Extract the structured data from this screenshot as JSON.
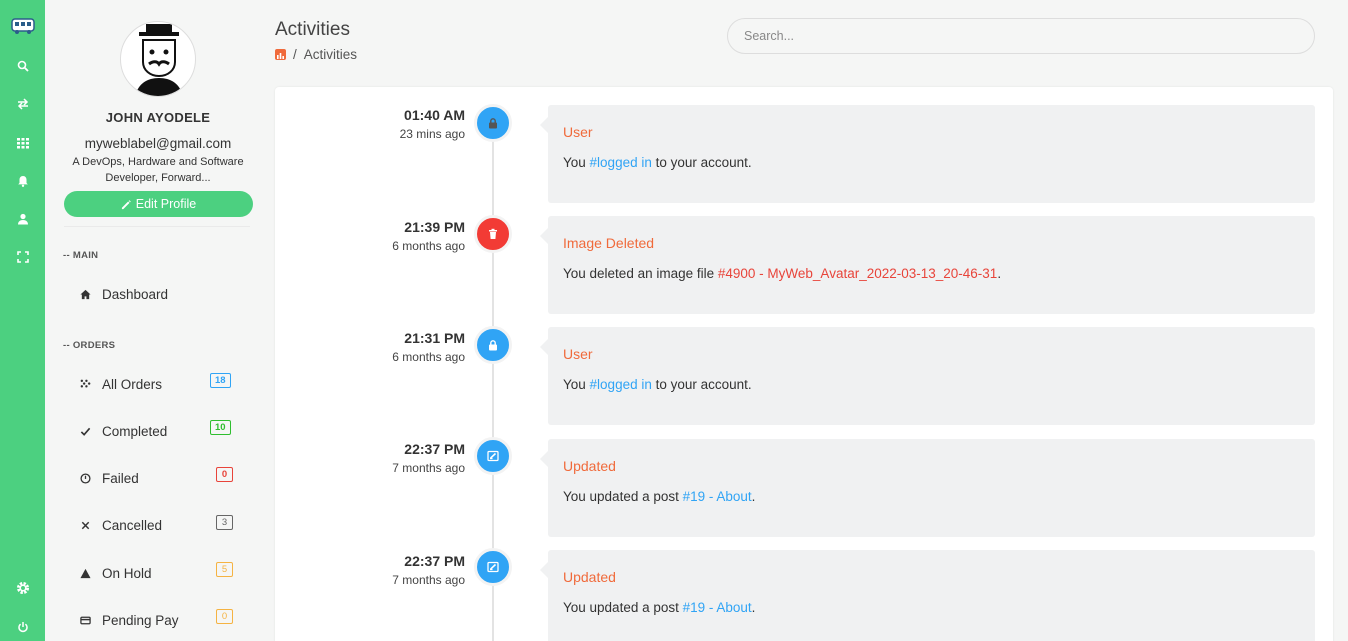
{
  "colors": {
    "accent": "#4cd080",
    "orange": "#f06a3b",
    "blue": "#30a4f5",
    "red": "#f23b35"
  },
  "rail": {
    "icons": [
      "logo-icon",
      "search-icon",
      "swap-icon",
      "grid-icon",
      "bell-icon",
      "user-icon",
      "fullscreen-icon",
      "gear-icon",
      "power-icon"
    ]
  },
  "profile": {
    "name": "JOHN AYODELE",
    "email": "myweblabel@gmail.com",
    "bio": "A DevOps, Hardware and Software Developer, Forward...",
    "edit_label": "Edit Profile"
  },
  "sidebar": {
    "main_heading": "-- MAIN",
    "dashboard_label": "Dashboard",
    "orders_heading": "-- ORDERS",
    "orders": [
      {
        "label": "All Orders",
        "count": "18",
        "icon": "scatter-icon",
        "color": "#30a4f5"
      },
      {
        "label": "Completed",
        "count": "10",
        "icon": "check-icon",
        "color": "#2fbe2f"
      },
      {
        "label": "Failed",
        "count": "0",
        "icon": "clock-icon",
        "color": "#e8443a"
      },
      {
        "label": "Cancelled",
        "count": "3",
        "icon": "times-icon",
        "color": "#666666"
      },
      {
        "label": "On Hold",
        "count": "5",
        "icon": "warning-icon",
        "color": "#f5b342"
      },
      {
        "label": "Pending Pay",
        "count": "0",
        "icon": "card-icon",
        "color": "#f5b342"
      }
    ]
  },
  "header": {
    "title": "Activities",
    "breadcrumb_sep": "/",
    "breadcrumb_current": "Activities",
    "search_placeholder": "Search..."
  },
  "activities": [
    {
      "time": "01:40 AM",
      "ago": "23 mins ago",
      "icon": "lock-icon",
      "color": "blue",
      "title": "User",
      "pre": "You ",
      "link": "#logged in",
      "post": " to your account.",
      "link_color": "blue"
    },
    {
      "time": "21:39 PM",
      "ago": "6 months ago",
      "icon": "trash-icon",
      "color": "red",
      "title": "Image Deleted",
      "pre": "You deleted an image file ",
      "link": "#4900 - MyWeb_Avatar_2022-03-13_20-46-31",
      "post": ".",
      "link_color": "red"
    },
    {
      "time": "21:31 PM",
      "ago": "6 months ago",
      "icon": "lock-icon",
      "color": "blue",
      "title": "User",
      "pre": "You ",
      "link": "#logged in",
      "post": " to your account.",
      "link_color": "blue"
    },
    {
      "time": "22:37 PM",
      "ago": "7 months ago",
      "icon": "edit-icon",
      "color": "blue",
      "title": "Updated",
      "pre": "You updated a post ",
      "link": "#19 - About",
      "post": ".",
      "link_color": "blue"
    },
    {
      "time": "22:37 PM",
      "ago": "7 months ago",
      "icon": "edit-icon",
      "color": "blue",
      "title": "Updated",
      "pre": "You updated a post ",
      "link": "#19 - About",
      "post": ".",
      "link_color": "blue"
    }
  ]
}
